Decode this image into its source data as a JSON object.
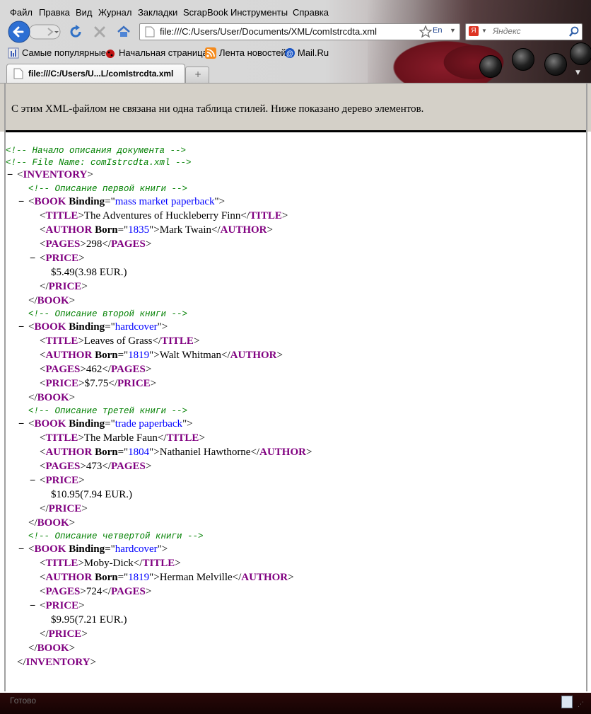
{
  "menu": [
    "Файл",
    "Правка",
    "Вид",
    "Журнал",
    "Закладки",
    "ScrapBook",
    "Инструменты",
    "Справка"
  ],
  "toolbar": {
    "url": "file:///C:/Users/User/Documents/XML/comIstrcdta.xml",
    "lang_indicator": "En",
    "search_placeholder": "Яндекс"
  },
  "bookmarks": [
    "Самые популярные",
    "Начальная страница",
    "Лента новостей",
    "Mail.Ru"
  ],
  "tab": {
    "title": "file:///C:/Users/U...L/comIstrcdta.xml"
  },
  "info_message": "С этим XML-файлом не связана ни одна таблица стилей. Ниже показано дерево элементов.",
  "xml": {
    "comment_start": "<!-- Начало описания документа -->",
    "comment_file": "<!-- File Name: comIstrcdta.xml  -->",
    "toggle": "−",
    "root": "INVENTORY",
    "attr_name": "Binding",
    "books": [
      {
        "comment": "<!-- Описание первой книги -->",
        "binding": "mass market paperback",
        "title": "The Adventures of Huckleberry Finn",
        "author": "Mark Twain",
        "born": "1835",
        "pages": "298",
        "price": "$5.49(3.98 EUR.)"
      },
      {
        "comment": "<!-- Описание второй книги -->",
        "binding": "hardcover",
        "title": "Leaves of Grass",
        "author": "Walt Whitman",
        "born": "1819",
        "pages": "462",
        "price": "$7.75"
      },
      {
        "comment": "<!-- Описание третей книги -->",
        "binding": "trade paperback",
        "title": "The Marble Faun",
        "author": "Nathaniel Hawthorne",
        "born": "1804",
        "pages": "473",
        "price": "$10.95(7.94 EUR.)"
      },
      {
        "comment": "<!-- Описание четвертой книги -->",
        "binding": "hardcover",
        "title": "Moby-Dick",
        "author": "Herman Melville",
        "born": "1819",
        "pages": "724",
        "price": "$9.95(7.21 EUR.)"
      }
    ]
  },
  "status": {
    "text": "Готово"
  },
  "colors": {
    "comment": "#008000",
    "tag": "#800080",
    "attr_value": "#0000ff",
    "info_bg": "#d4d0c8"
  }
}
